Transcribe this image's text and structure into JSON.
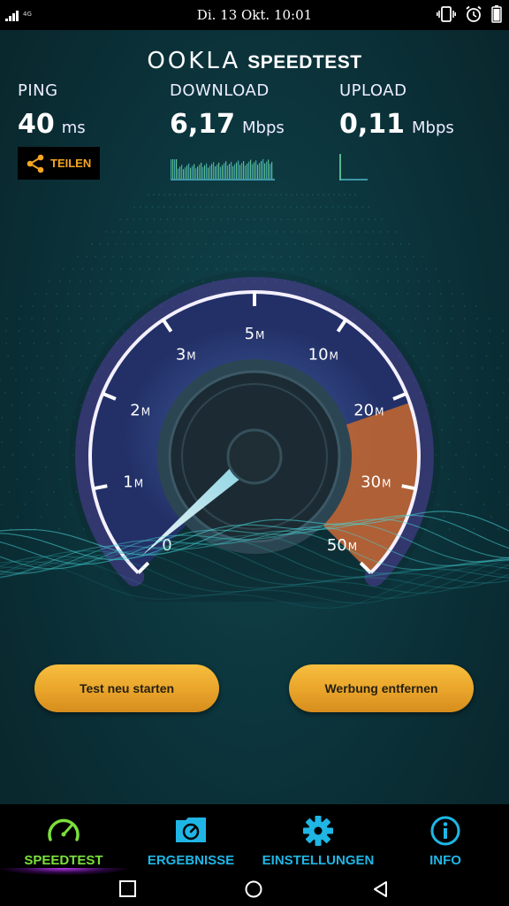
{
  "status_bar": {
    "network": "4G",
    "time": "Di. 13 Okt. 10:01",
    "icons": [
      "signal-icon",
      "vibrate-icon",
      "alarm-icon",
      "battery-icon"
    ]
  },
  "logo": {
    "brand": "OOKLA",
    "product": "SPEEDTEST"
  },
  "results": {
    "ping": {
      "label": "PING",
      "value": "40",
      "unit": "ms"
    },
    "download": {
      "label": "DOWNLOAD",
      "value": "6,17",
      "unit": "Mbps"
    },
    "upload": {
      "label": "UPLOAD",
      "value": "0,11",
      "unit": "Mbps"
    }
  },
  "share": {
    "label": "TEILEN",
    "icon": "share-icon"
  },
  "gauge": {
    "scale": [
      {
        "num": "0",
        "suffix": ""
      },
      {
        "num": "1",
        "suffix": "M"
      },
      {
        "num": "2",
        "suffix": "M"
      },
      {
        "num": "3",
        "suffix": "M"
      },
      {
        "num": "5",
        "suffix": "M"
      },
      {
        "num": "10",
        "suffix": "M"
      },
      {
        "num": "20",
        "suffix": "M"
      },
      {
        "num": "30",
        "suffix": "M"
      },
      {
        "num": "50",
        "suffix": "M"
      }
    ],
    "needle_value_mbps": 0.11
  },
  "buttons": {
    "restart": "Test neu starten",
    "remove_ads": "Werbung entfernen"
  },
  "tabs": [
    {
      "label": "SPEEDTEST",
      "icon": "speedometer-icon",
      "active": true
    },
    {
      "label": "ERGEBNISSE",
      "icon": "results-folder-icon",
      "active": false
    },
    {
      "label": "EINSTELLUNGEN",
      "icon": "gear-icon",
      "active": false
    },
    {
      "label": "INFO",
      "icon": "info-icon",
      "active": false
    }
  ],
  "colors": {
    "accent_orange": "#f6a623",
    "tab_blue": "#1fb6e6",
    "tab_active_green": "#7be03b",
    "gauge_purple": "#8a5cf0"
  }
}
